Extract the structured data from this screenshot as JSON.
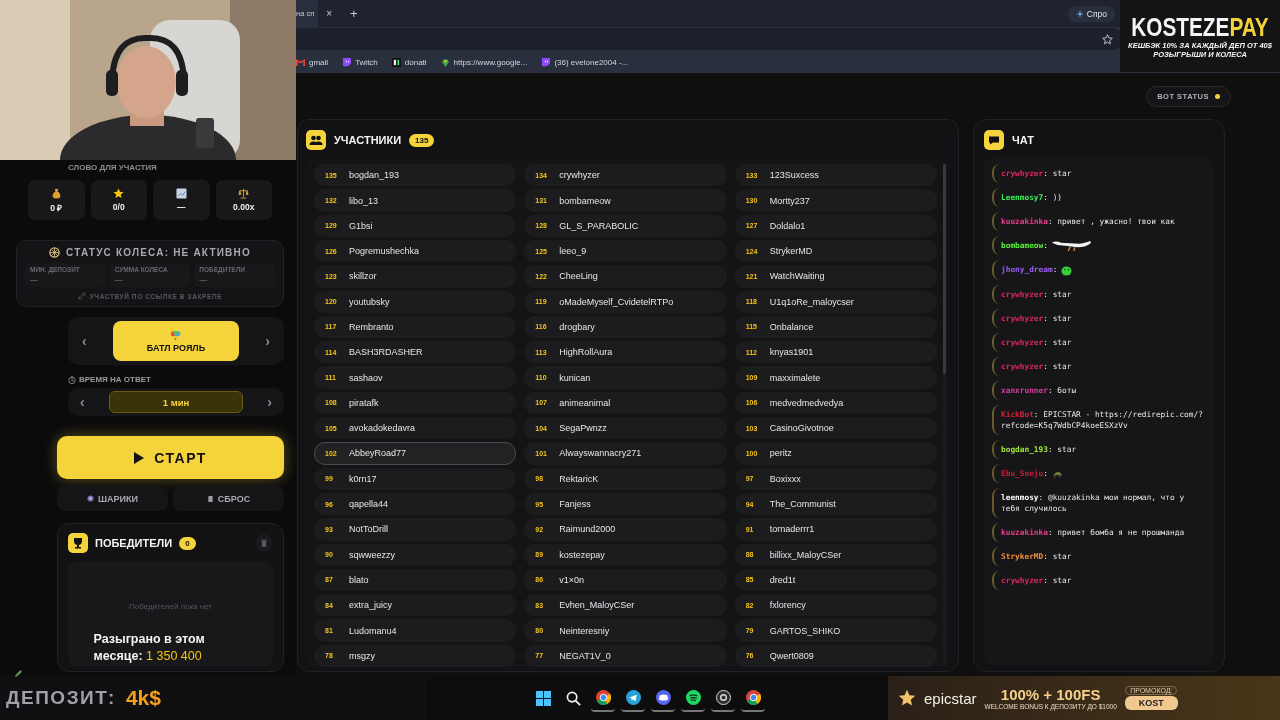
{
  "browser": {
    "tabs": [
      {
        "label": "на сп",
        "selected": true
      }
    ],
    "close_tab": "×",
    "new_tab": "+",
    "side_button": "Спро",
    "bookmarks": [
      {
        "kind": "mail",
        "label": "gmail"
      },
      {
        "kind": "stream",
        "label": "Twitch"
      },
      {
        "kind": "letters",
        "label": "donati"
      },
      {
        "kind": "pin",
        "label": "https://www.google..."
      },
      {
        "kind": "stream",
        "label": "(36) evelone2004 -..."
      }
    ]
  },
  "overlay_brand": {
    "name": "KOSTEZE",
    "accent": "PAY",
    "line_1": "КЕШБЭК 10% ЗА КАЖДЫЙ ДЕП ОТ 40$",
    "line_2": "РОЗЫГРЫШИ И КОЛЕСА"
  },
  "bot_status": {
    "label": "BOT STATUS",
    "active": true
  },
  "controls": {
    "word_label": "СЛОВО ДЛЯ УЧАСТИЯ",
    "stats": [
      {
        "kind": "money",
        "value": "0 ₽"
      },
      {
        "kind": "star",
        "value": "0/0"
      },
      {
        "kind": "chart",
        "value": "—"
      },
      {
        "kind": "scales",
        "value": "0.00x"
      }
    ],
    "wheel_status": {
      "title": "СТАТУС КОЛЕСА: НЕ АКТИВНО",
      "fields": [
        {
          "label": "МИН. ДЕПОЗИТ",
          "value": "—"
        },
        {
          "label": "СУММА КОЛЕСА",
          "value": "—"
        },
        {
          "label": "ПОБЕДИТЕЛИ",
          "value": "—"
        }
      ],
      "link": "УЧАСТВУЙ ПО ССЫЛКЕ В ЗАКРЕПЕ"
    },
    "mode": {
      "prev": "‹",
      "next": "›",
      "label": "БАТЛ РОЯЛЬ"
    },
    "timer": {
      "label": "ВРЕМЯ НА ОТВЕТ",
      "prev": "‹",
      "next": "›",
      "value": "1 мин"
    },
    "start": "СТАРТ",
    "actions": [
      {
        "kind": "balls",
        "label": "ШАРИКИ"
      },
      {
        "kind": "reset",
        "label": "СБРОС"
      }
    ],
    "winners": {
      "title": "ПОБЕДИТЕЛИ",
      "count": "0",
      "empty": "Победителей пока нет"
    }
  },
  "monthly": {
    "label": "Разыграно в этом месяце:",
    "amount": "1 350 400"
  },
  "participants": {
    "title": "УЧАСТНИКИ",
    "count": "135",
    "items": [
      {
        "number": "135",
        "name": "bogdan_193",
        "selected": false
      },
      {
        "number": "134",
        "name": "crywhyzer",
        "selected": false
      },
      {
        "number": "133",
        "name": "123Suxcess",
        "selected": false
      },
      {
        "number": "132",
        "name": "libo_13",
        "selected": false
      },
      {
        "number": "131",
        "name": "bombameow",
        "selected": false
      },
      {
        "number": "130",
        "name": "Mortty237",
        "selected": false
      },
      {
        "number": "129",
        "name": "G1bsi",
        "selected": false
      },
      {
        "number": "128",
        "name": "GL_S_PARABOLIC",
        "selected": false
      },
      {
        "number": "127",
        "name": "Doldalo1",
        "selected": false
      },
      {
        "number": "126",
        "name": "Pogremushechka",
        "selected": false
      },
      {
        "number": "125",
        "name": "leeo_9",
        "selected": false
      },
      {
        "number": "124",
        "name": "StrykerMD",
        "selected": false
      },
      {
        "number": "123",
        "name": "skillzor",
        "selected": false
      },
      {
        "number": "122",
        "name": "CheeLing",
        "selected": false
      },
      {
        "number": "121",
        "name": "WatchWaiting",
        "selected": false
      },
      {
        "number": "120",
        "name": "youtubsky",
        "selected": false
      },
      {
        "number": "119",
        "name": "oMadeMyself_CvidetelRTPo",
        "selected": false
      },
      {
        "number": "118",
        "name": "U1q1oRe_maloycser",
        "selected": false
      },
      {
        "number": "117",
        "name": "Rembranto",
        "selected": false
      },
      {
        "number": "116",
        "name": "drogbary",
        "selected": false
      },
      {
        "number": "115",
        "name": "Onbalance",
        "selected": false
      },
      {
        "number": "114",
        "name": "BASH3RDASHER",
        "selected": false
      },
      {
        "number": "113",
        "name": "HighRollAura",
        "selected": false
      },
      {
        "number": "112",
        "name": "knyas1901",
        "selected": false
      },
      {
        "number": "111",
        "name": "sashaov",
        "selected": false
      },
      {
        "number": "110",
        "name": "kunican",
        "selected": false
      },
      {
        "number": "109",
        "name": "maxximalete",
        "selected": false
      },
      {
        "number": "108",
        "name": "piratafk",
        "selected": false
      },
      {
        "number": "107",
        "name": "animeanimal",
        "selected": false
      },
      {
        "number": "106",
        "name": "medvedmedvedya",
        "selected": false
      },
      {
        "number": "105",
        "name": "avokadokedavra",
        "selected": false
      },
      {
        "number": "104",
        "name": "SegaPwnzz",
        "selected": false
      },
      {
        "number": "103",
        "name": "CasinoGivotnoe",
        "selected": false
      },
      {
        "number": "102",
        "name": "AbbeyRoad77",
        "selected": true
      },
      {
        "number": "101",
        "name": "Alwayswannacry271",
        "selected": false
      },
      {
        "number": "100",
        "name": "peritz",
        "selected": false
      },
      {
        "number": "99",
        "name": "k0rn17",
        "selected": false
      },
      {
        "number": "98",
        "name": "RektaricK",
        "selected": false
      },
      {
        "number": "97",
        "name": "Boxixxx",
        "selected": false
      },
      {
        "number": "96",
        "name": "qapella44",
        "selected": false
      },
      {
        "number": "95",
        "name": "Fanjess",
        "selected": false
      },
      {
        "number": "94",
        "name": "The_Communist",
        "selected": false
      },
      {
        "number": "93",
        "name": "NotToDrill",
        "selected": false
      },
      {
        "number": "92",
        "name": "Raimund2000",
        "selected": false
      },
      {
        "number": "91",
        "name": "tornaderrr1",
        "selected": false
      },
      {
        "number": "90",
        "name": "sqwweezzy",
        "selected": false
      },
      {
        "number": "89",
        "name": "kostezepay",
        "selected": false
      },
      {
        "number": "88",
        "name": "billixx_MaloyCSer",
        "selected": false
      },
      {
        "number": "87",
        "name": "blato",
        "selected": false
      },
      {
        "number": "86",
        "name": "v1×0n",
        "selected": false
      },
      {
        "number": "85",
        "name": "dred1t",
        "selected": false
      },
      {
        "number": "84",
        "name": "extra_juicy",
        "selected": false
      },
      {
        "number": "83",
        "name": "Evhen_MaloyCSer",
        "selected": false
      },
      {
        "number": "82",
        "name": "fxlorency",
        "selected": false
      },
      {
        "number": "81",
        "name": "Ludomanu4",
        "selected": false
      },
      {
        "number": "80",
        "name": "Neinteresniy",
        "selected": false
      },
      {
        "number": "79",
        "name": "GARTOS_SHIKO",
        "selected": false
      },
      {
        "number": "78",
        "name": "msgzy",
        "selected": false
      },
      {
        "number": "77",
        "name": "NEGAT1V_0",
        "selected": false
      },
      {
        "number": "76",
        "name": "Qwert0809",
        "selected": false
      }
    ]
  },
  "chat": {
    "title": "ЧАТ",
    "messages": [
      {
        "user": "crywhyzer",
        "color": "#e0245e",
        "kind": "text",
        "text": ": star"
      },
      {
        "user": "Leenmosy7",
        "color": "#3cf05a",
        "kind": "text",
        "text": ": ))"
      },
      {
        "user": "kuuzakinka",
        "color": "#e83e8c",
        "kind": "text",
        "text": ": привет , ужасно! твои как"
      },
      {
        "user": "bombameow",
        "color": "#5cf03c",
        "kind": "goose",
        "text": ":"
      },
      {
        "user": "jhony_dream",
        "color": "#9b5cf0",
        "kind": "blob",
        "text": ":"
      },
      {
        "user": "crywhyzer",
        "color": "#e0245e",
        "kind": "text",
        "text": ": star"
      },
      {
        "user": "crywhyzer",
        "color": "#e0245e",
        "kind": "text",
        "text": ": star"
      },
      {
        "user": "crywhyzer",
        "color": "#e0245e",
        "kind": "text",
        "text": ": star"
      },
      {
        "user": "crywhyzer",
        "color": "#e0245e",
        "kind": "text",
        "text": ": star"
      },
      {
        "user": "xanxrunner",
        "color": "#d63fa0",
        "kind": "text",
        "text": ": боты"
      },
      {
        "user": "KickBot",
        "color": "#d0243a",
        "kind": "text",
        "text": ": EPICSTAR - https://redirepic.com/?refcode=K5q7WdbCP4koeESXzVv"
      },
      {
        "user": "bogdan_193",
        "color": "#9ee83c",
        "kind": "text",
        "text": ": star"
      },
      {
        "user": "Ebu_Sneju",
        "color": "#c0203a",
        "kind": "critter",
        "text": ":"
      },
      {
        "user": "leenmosy",
        "color": "#ffffff",
        "kind": "text",
        "text": ": @kuuzakinka мои нормал, что у тебя случилось"
      },
      {
        "user": "kuuzakinka",
        "color": "#e83e8c",
        "kind": "text",
        "text": ": привет бомба я не прошманда"
      },
      {
        "user": "StrykerMD",
        "color": "#f0903c",
        "kind": "text",
        "text": ": star"
      },
      {
        "user": "crywhyzer",
        "color": "#e0245e",
        "kind": "text",
        "text": ": star"
      }
    ]
  },
  "deposit": {
    "label": "ДЕПОЗИТ:",
    "value": "4k$"
  },
  "taskbar": [
    {
      "kind": "start",
      "active": false
    },
    {
      "kind": "search",
      "active": false
    },
    {
      "kind": "browser",
      "active": true
    },
    {
      "kind": "messenger",
      "active": true
    },
    {
      "kind": "voice",
      "active": true
    },
    {
      "kind": "music",
      "active": true
    },
    {
      "kind": "recorder",
      "active": true
    },
    {
      "kind": "browser",
      "active": true
    }
  ],
  "promo": {
    "brand": "epicstar",
    "headline": "100% + 100FS",
    "subline": "WELCOME BONUS К ДЕПОЗИТУ ДО $1000",
    "code_label": "ПРОМОКОД:",
    "code": "KOST"
  }
}
